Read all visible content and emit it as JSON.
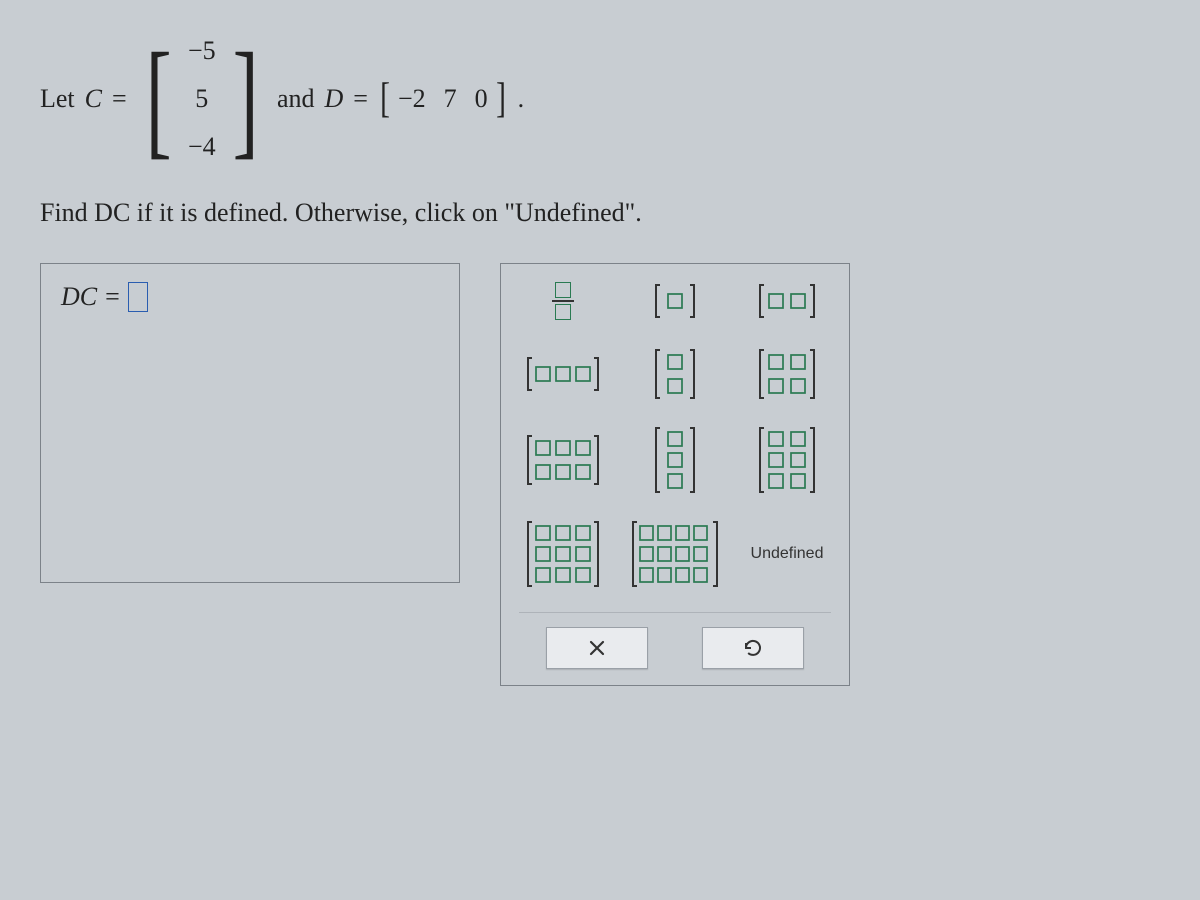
{
  "problem": {
    "let_label": "Let",
    "C_name": "C",
    "equals": "=",
    "C_values": [
      "−5",
      "5",
      "−4"
    ],
    "and_label": "and",
    "D_name": "D",
    "D_values": [
      "−2",
      "7",
      "0"
    ],
    "period": "."
  },
  "instruction": "Find DC if it is defined. Otherwise, click on \"Undefined\".",
  "answer": {
    "lhs": "DC",
    "eq": "="
  },
  "palette": {
    "undefined_label": "Undefined"
  },
  "colors": {
    "accent_green": "#2a7a52",
    "accent_blue": "#2a5db0",
    "border": "#7c8289"
  },
  "chart_data": {
    "type": "table",
    "title": "Matrix multiplication problem",
    "matrices": {
      "C": {
        "rows": 3,
        "cols": 1,
        "data": [
          [
            -5
          ],
          [
            5
          ],
          [
            -4
          ]
        ]
      },
      "D": {
        "rows": 1,
        "cols": 3,
        "data": [
          [
            -2,
            7,
            0
          ]
        ]
      }
    },
    "target": "DC"
  }
}
